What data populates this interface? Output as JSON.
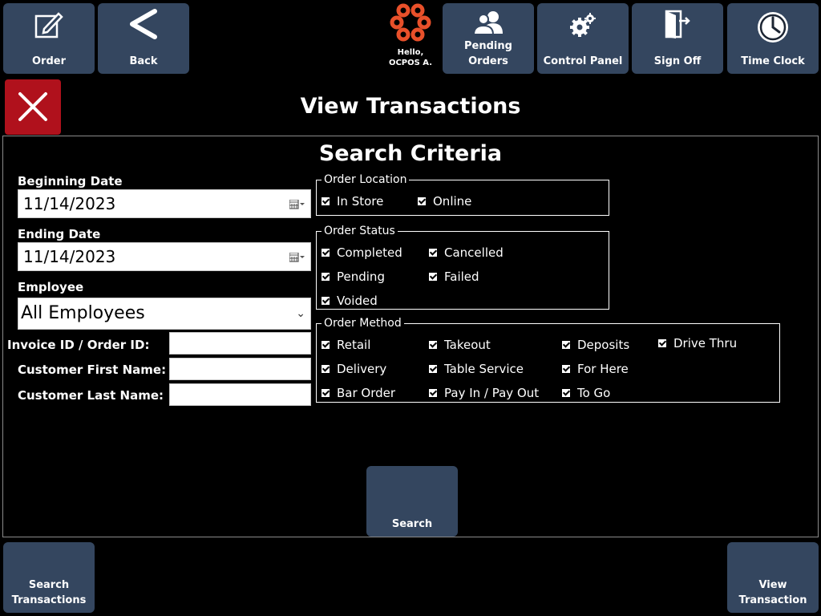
{
  "toolbar": {
    "order_label": "Order",
    "back_label": "Back",
    "user_greeting": "Hello,",
    "user_name": "OCPOS A.",
    "pending_line1": "Pending",
    "pending_line2": "Orders",
    "control_panel_label": "Control Panel",
    "sign_off_label": "Sign Off",
    "time_clock_label": "Time Clock"
  },
  "page": {
    "title": "View Transactions",
    "subtitle": "Search Criteria"
  },
  "form": {
    "beginning_date_label": "Beginning Date",
    "beginning_date_value": "11/14/2023",
    "ending_date_label": "Ending Date",
    "ending_date_value": "11/14/2023",
    "employee_label": "Employee",
    "employee_value": "All Employees",
    "invoice_label": "Invoice ID / Order ID:",
    "first_name_label": "Customer First Name:",
    "last_name_label": "Customer Last Name:"
  },
  "order_location": {
    "legend": "Order Location",
    "options": [
      {
        "label": "In Store",
        "checked": true
      },
      {
        "label": "Online",
        "checked": true
      }
    ]
  },
  "order_status": {
    "legend": "Order Status",
    "options": [
      {
        "label": "Completed",
        "checked": true
      },
      {
        "label": "Cancelled",
        "checked": true
      },
      {
        "label": "Pending",
        "checked": true
      },
      {
        "label": "Failed",
        "checked": true
      },
      {
        "label": "Voided",
        "checked": true
      }
    ]
  },
  "order_method": {
    "legend": "Order Method",
    "options": [
      {
        "label": "Retail",
        "checked": true
      },
      {
        "label": "Takeout",
        "checked": true
      },
      {
        "label": "Deposits",
        "checked": true
      },
      {
        "label": "Drive Thru",
        "checked": true
      },
      {
        "label": "Delivery",
        "checked": true
      },
      {
        "label": "Table Service",
        "checked": true
      },
      {
        "label": "For Here",
        "checked": true
      },
      {
        "label": "Bar Order",
        "checked": true
      },
      {
        "label": "Pay In / Pay Out",
        "checked": true
      },
      {
        "label": "To Go",
        "checked": true
      }
    ]
  },
  "actions": {
    "search_label": "Search",
    "search_transactions_line1": "Search",
    "search_transactions_line2": "Transactions",
    "view_transaction_line1": "View",
    "view_transaction_line2": "Transaction"
  },
  "colors": {
    "tile": "#34465f",
    "close": "#b0111c",
    "logo": "#e8502a"
  }
}
